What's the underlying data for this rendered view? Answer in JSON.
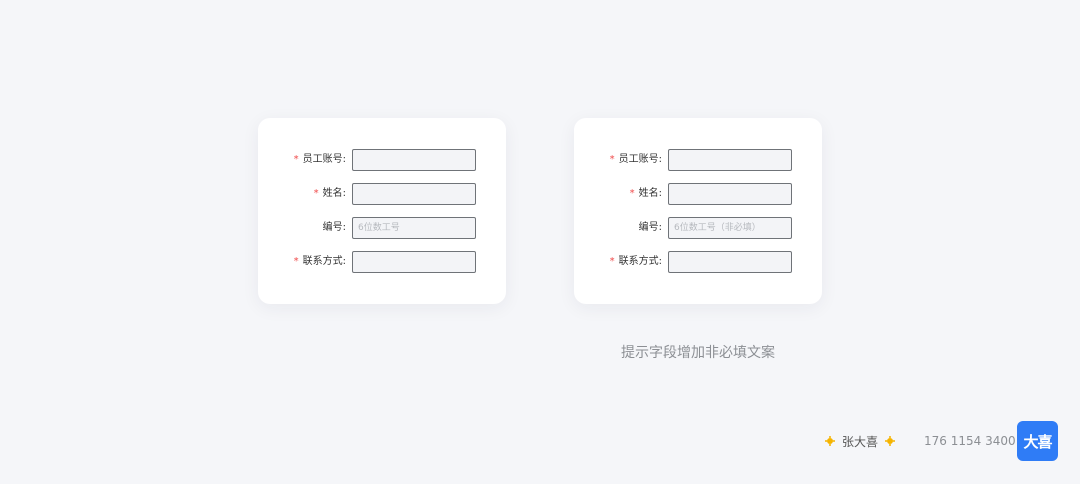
{
  "forms": [
    {
      "fields": [
        {
          "label": "员工账号:",
          "required": true,
          "value": "",
          "placeholder": ""
        },
        {
          "label": "姓名:",
          "required": true,
          "value": "",
          "placeholder": ""
        },
        {
          "label": "编号:",
          "required": false,
          "value": "",
          "placeholder": "6位数工号"
        },
        {
          "label": "联系方式:",
          "required": true,
          "value": "",
          "placeholder": ""
        }
      ]
    },
    {
      "fields": [
        {
          "label": "员工账号:",
          "required": true,
          "value": "",
          "placeholder": ""
        },
        {
          "label": "姓名:",
          "required": true,
          "value": "",
          "placeholder": ""
        },
        {
          "label": "编号:",
          "required": false,
          "value": "",
          "placeholder": "6位数工号（非必填）"
        },
        {
          "label": "联系方式:",
          "required": true,
          "value": "",
          "placeholder": ""
        }
      ]
    }
  ],
  "required_mark": "*",
  "caption": "提示字段增加非必填文案",
  "footer": {
    "author": "张大喜",
    "phone": "176 1154 3400",
    "logo_text": "大喜",
    "icon": "sun-icon"
  },
  "colors": {
    "background": "#f5f6f9",
    "required": "#f04a4a",
    "logo": "#2f7cf6",
    "field_border": "#6f7378"
  }
}
